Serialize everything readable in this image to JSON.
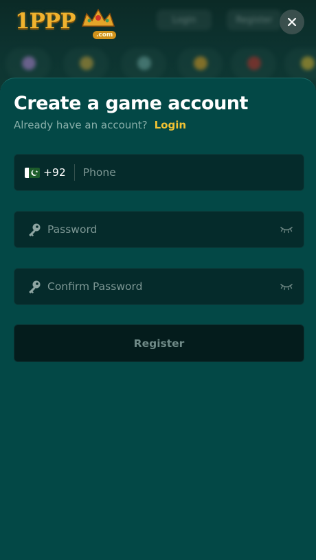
{
  "header": {
    "logo_text": "1PPP",
    "logo_suffix": ".com",
    "login_label": "Login",
    "register_label": "Register"
  },
  "close_icon": "close-icon",
  "modal": {
    "title": "Create a game account",
    "subtitle": "Already have an account?",
    "login_link": "Login",
    "phone": {
      "country_code": "+92",
      "flag_icon": "pakistan-flag-icon",
      "placeholder": "Phone",
      "value": ""
    },
    "password": {
      "placeholder": "Password",
      "value": "",
      "icon": "key-icon",
      "toggle_icon": "eye-closed-icon"
    },
    "confirm_password": {
      "placeholder": "Confirm Password",
      "value": "",
      "icon": "key-icon",
      "toggle_icon": "eye-closed-icon"
    },
    "register_button": "Register"
  },
  "colors": {
    "sheet_bg": "#034846",
    "field_bg": "#052b2b",
    "accent_link": "#f1c233",
    "button_bg": "#041c1c"
  }
}
